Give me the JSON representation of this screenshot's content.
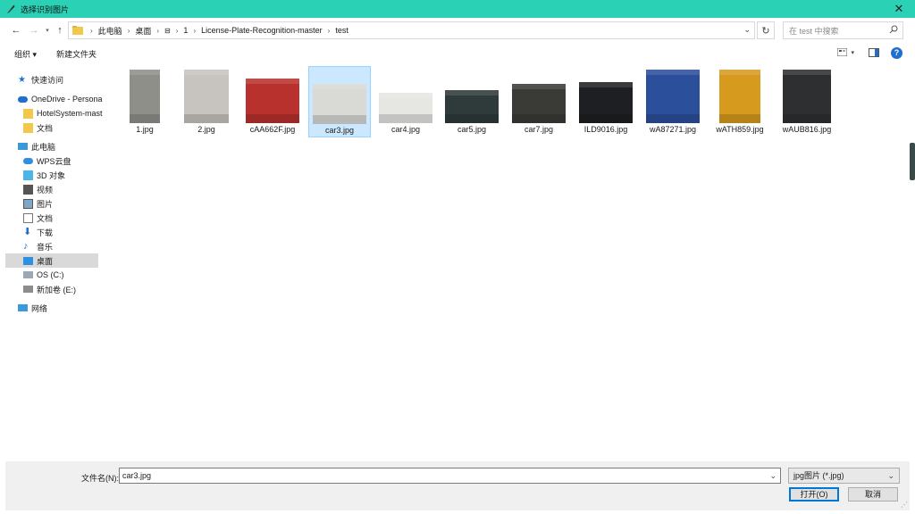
{
  "window": {
    "title": "选择识别图片"
  },
  "breadcrumb": {
    "items": [
      "此电脑",
      "桌面",
      "1",
      "License-Plate-Recognition-master",
      "test"
    ]
  },
  "search": {
    "placeholder": "在 test 中搜索"
  },
  "commands": {
    "organize": "组织 ▾",
    "new_folder": "新建文件夹"
  },
  "sidebar": {
    "items": [
      {
        "label": "快速访问",
        "icon": "star-icon"
      },
      {
        "label": "OneDrive - Persona",
        "icon": "cloud-icon"
      },
      {
        "label": "HotelSystem-mast",
        "icon": "folder-icon"
      },
      {
        "label": "文档",
        "icon": "folder-icon"
      },
      {
        "label": "此电脑",
        "icon": "computer-icon"
      },
      {
        "label": "WPS云盘",
        "icon": "cloud-icon"
      },
      {
        "label": "3D 对象",
        "icon": "cube-icon"
      },
      {
        "label": "视频",
        "icon": "video-icon"
      },
      {
        "label": "图片",
        "icon": "picture-icon"
      },
      {
        "label": "文档",
        "icon": "document-icon"
      },
      {
        "label": "下载",
        "icon": "download-icon"
      },
      {
        "label": "音乐",
        "icon": "music-icon"
      },
      {
        "label": "桌面",
        "icon": "desktop-icon"
      },
      {
        "label": "OS (C:)",
        "icon": "drive-icon"
      },
      {
        "label": "新加卷 (E:)",
        "icon": "drive-icon"
      },
      {
        "label": "网络",
        "icon": "network-icon"
      }
    ]
  },
  "files": [
    {
      "name": "1.jpg",
      "color": "#8f8f8a"
    },
    {
      "name": "2.jpg",
      "color": "#c7c4bf"
    },
    {
      "name": "cAA662F.jpg",
      "color": "#b8312c"
    },
    {
      "name": "car3.jpg",
      "color": "#d9d9d6"
    },
    {
      "name": "car4.jpg",
      "color": "#e6e6e3"
    },
    {
      "name": "car5.jpg",
      "color": "#2f3a3a"
    },
    {
      "name": "car7.jpg",
      "color": "#3a3a36"
    },
    {
      "name": "ILD9016.jpg",
      "color": "#1d1f22"
    },
    {
      "name": "wA87271.jpg",
      "color": "#2c4f9c"
    },
    {
      "name": "wATH859.jpg",
      "color": "#d69a1e"
    },
    {
      "name": "wAUB816.jpg",
      "color": "#2d2f31"
    }
  ],
  "footer": {
    "filename_label": "文件名(N):",
    "filename_value": "car3.jpg",
    "filter_value": "jpg图片 (*.jpg)",
    "open_label": "打开(O)",
    "cancel_label": "取消"
  },
  "colors": {
    "titlebar": "#2bd1b5",
    "selection": "#cce8ff",
    "accent": "#0078d7"
  }
}
